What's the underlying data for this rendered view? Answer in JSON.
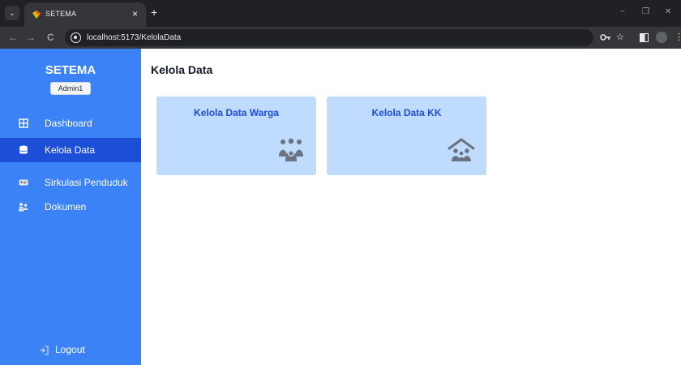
{
  "browser": {
    "tab_title": "SETEMA",
    "tab_close": "×",
    "new_tab": "+",
    "url": "localhost:5173/KelolaData",
    "back": "←",
    "forward": "→",
    "reload": "C",
    "bookmark_star": "☆"
  },
  "sidebar": {
    "brand": "SETEMA",
    "user_badge": "Admin1",
    "items": [
      {
        "label": "Dashboard",
        "icon": "table-icon",
        "active": false
      },
      {
        "label": "Kelola Data",
        "icon": "database-icon",
        "active": true
      },
      {
        "label": "Sirkulasi Penduduk",
        "icon": "id-card-icon",
        "active": false
      },
      {
        "label": "Dokumen",
        "icon": "document-users-icon",
        "active": false
      }
    ],
    "logout": "Logout"
  },
  "main": {
    "title": "Kelola Data",
    "cards": [
      {
        "title": "Kelola Data Warga",
        "icon": "people-group-icon"
      },
      {
        "title": "Kelola Data KK",
        "icon": "house-family-icon"
      }
    ]
  },
  "colors": {
    "sidebar": "#3b82f6",
    "sidebar_active": "#1d4ed8",
    "card_bg": "#bfdbfe",
    "card_title": "#1d4ed8",
    "icon_gray": "#6b7280"
  }
}
